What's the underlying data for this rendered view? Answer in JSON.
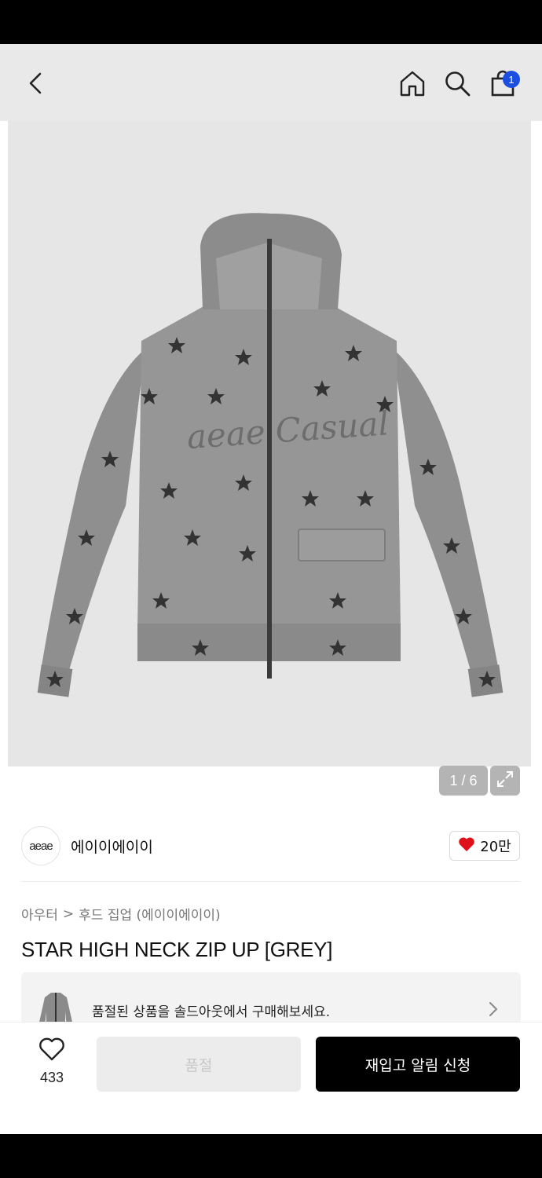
{
  "header": {
    "back_icon": "chevron-left-icon",
    "home_icon": "home-icon",
    "search_icon": "search-icon",
    "bag_icon": "shopping-bag-icon",
    "bag_badge": "1",
    "badge_color": "#1c4fe0"
  },
  "gallery": {
    "counter": "1 / 6",
    "expand_icon": "expand-icon",
    "print_text": "aeae Casual"
  },
  "brand": {
    "logo_text": "aeae",
    "name": "에이이에이이",
    "like_count": "20만",
    "like_icon": "heart-filled-icon",
    "like_color": "#e0101a"
  },
  "breadcrumb": {
    "category": "아우터",
    "separator": ">",
    "subcategory": "후드 집업 (에이이에이이)"
  },
  "product": {
    "title": "STAR HIGH NECK ZIP UP [GREY]"
  },
  "soldout_banner": {
    "text": "품절된 상품을 솔드아웃에서 구매해보세요.",
    "chevron_icon": "chevron-right-icon"
  },
  "bottom_bar": {
    "wish_icon": "heart-outline-icon",
    "wish_count": "433",
    "soldout_label": "품절",
    "restock_label": "재입고 알림 신청"
  }
}
